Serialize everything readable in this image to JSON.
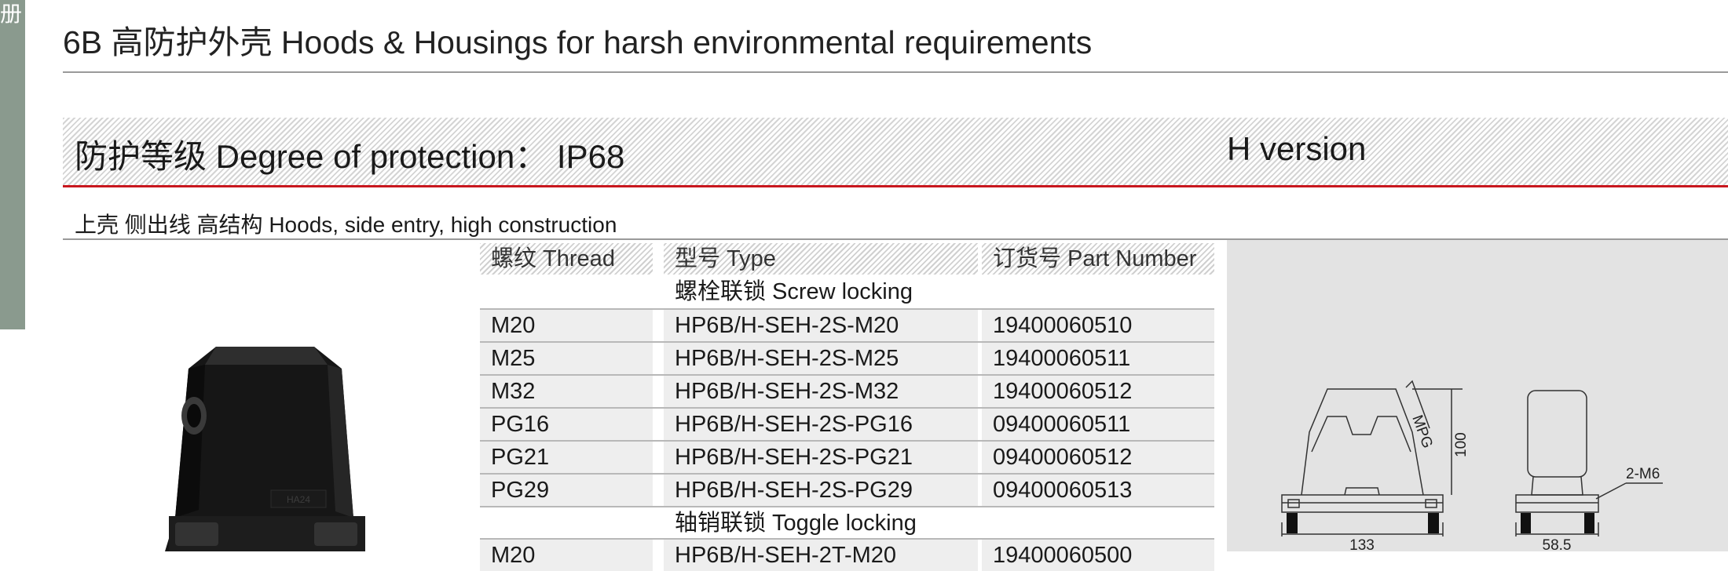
{
  "side_tab": {
    "text": "册"
  },
  "page_title": "6B 高防护外壳 Hoods & Housings for harsh environmental requirements",
  "band": {
    "left": "防护等级 Degree of protection： IP68",
    "right": "H version"
  },
  "section_label": "上壳 侧出线 高结构 Hoods, side entry, high construction",
  "table": {
    "headers": [
      "螺纹 Thread",
      "型号 Type",
      "订货号 Part Number"
    ],
    "groups": [
      {
        "label": "螺栓联锁 Screw locking",
        "rows": [
          {
            "thread": "M20",
            "type": "HP6B/H-SEH-2S-M20",
            "part": "19400060510"
          },
          {
            "thread": "M25",
            "type": "HP6B/H-SEH-2S-M25",
            "part": "19400060511"
          },
          {
            "thread": "M32",
            "type": "HP6B/H-SEH-2S-M32",
            "part": "19400060512"
          },
          {
            "thread": "PG16",
            "type": "HP6B/H-SEH-2S-PG16",
            "part": "09400060511"
          },
          {
            "thread": "PG21",
            "type": "HP6B/H-SEH-2S-PG21",
            "part": "09400060512"
          },
          {
            "thread": "PG29",
            "type": "HP6B/H-SEH-2S-PG29",
            "part": "09400060513"
          }
        ]
      },
      {
        "label": "轴销联锁 Toggle locking",
        "rows": [
          {
            "thread": "M20",
            "type": "HP6B/H-SEH-2T-M20",
            "part": "19400060500"
          }
        ]
      }
    ]
  },
  "drawing": {
    "mpg": "MPG",
    "height": "100",
    "screw": "2-M6",
    "width_front": "133",
    "width_side": "58.5"
  },
  "product_photo": {
    "marking": "HA24"
  }
}
